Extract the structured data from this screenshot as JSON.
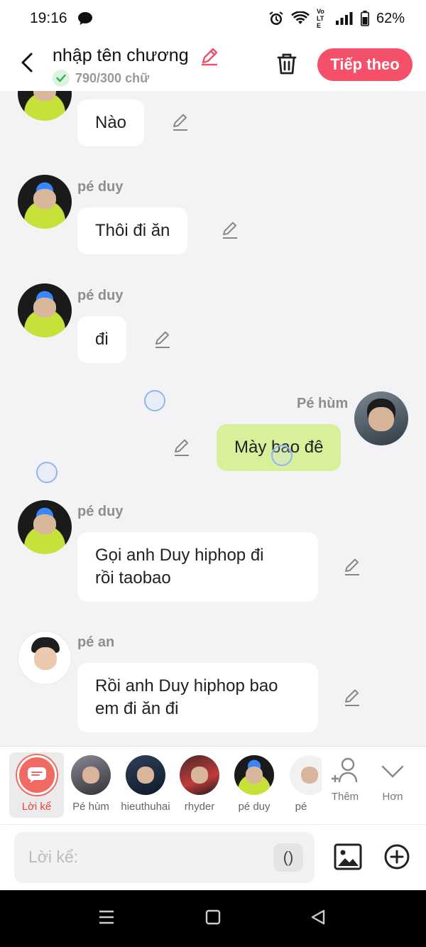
{
  "status_bar": {
    "time": "19:16",
    "battery": "62%",
    "lte_label": "Vo LTE"
  },
  "header": {
    "title": "nhập tên chương",
    "word_count": "790/300 chữ",
    "next_label": "Tiếp theo"
  },
  "messages": [
    {
      "sender": "",
      "text": "Nào",
      "side": "left"
    },
    {
      "sender": "pé duy",
      "text": "Thôi đi ăn",
      "side": "left"
    },
    {
      "sender": "pé duy",
      "text": "đi",
      "side": "left"
    },
    {
      "sender": "Pé hùm",
      "text": "Mày bao đê",
      "side": "right"
    },
    {
      "sender": "pé duy",
      "text": [
        "Gọi anh Duy hiphop đi",
        "rồi taobao"
      ],
      "side": "left"
    },
    {
      "sender": "pé an",
      "text": [
        "Rồi anh Duy hiphop bao",
        "em đi ăn đi"
      ],
      "side": "left"
    }
  ],
  "characters": [
    {
      "label": "Lời kể",
      "icon": "chat-bubble-icon",
      "selected": true
    },
    {
      "label": "Pé hùm"
    },
    {
      "label": "hieuthuhai"
    },
    {
      "label": "rhyder"
    },
    {
      "label": "pé duy"
    },
    {
      "label": "pé"
    }
  ],
  "char_actions": {
    "add_label": "Thêm",
    "more_label": "Hơn"
  },
  "composer": {
    "placeholder": "Lời kể:",
    "paren_label": "()"
  },
  "colors": {
    "accent": "#f4506a",
    "my_bubble": "#d8f09a",
    "narrator": "#f06a63"
  }
}
